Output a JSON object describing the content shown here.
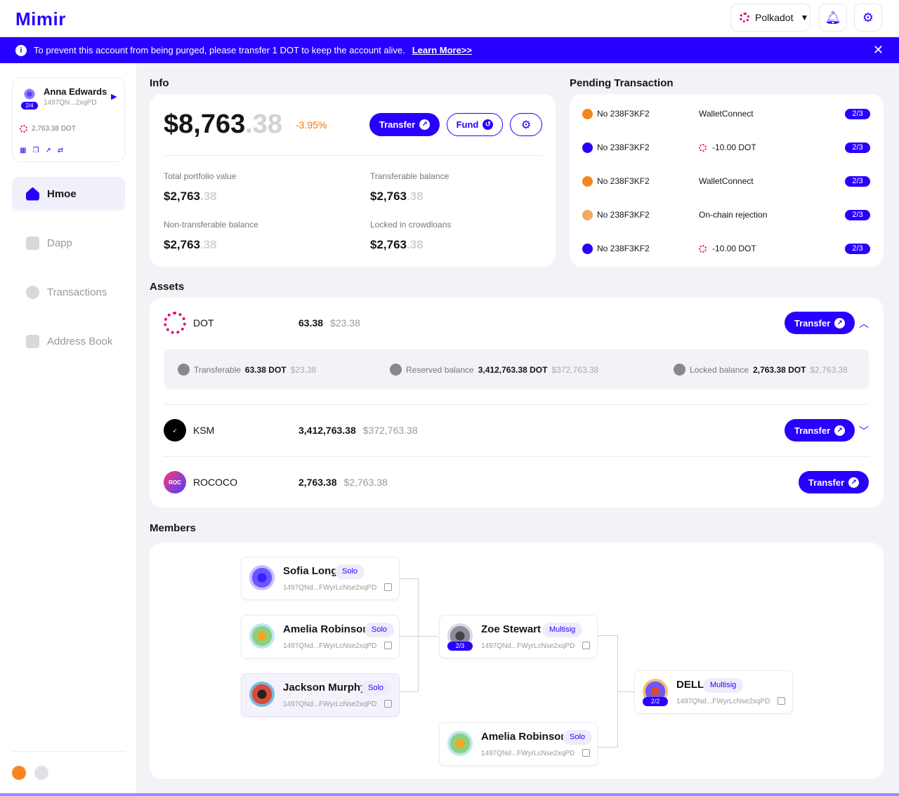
{
  "app": {
    "logo": "Mimir"
  },
  "header": {
    "network": "Polkadot",
    "notif_icon": "bell-icon",
    "settings_icon": "gear-icon"
  },
  "banner": {
    "message": "To prevent this account from being purged, please transfer 1 DOT to keep the account alive.",
    "link": "Learn More>>"
  },
  "account": {
    "name": "Anna Edwards",
    "badge": "2/4",
    "address": "1497QN...2xqPD",
    "balance": "2,763.38 DOT"
  },
  "nav": [
    {
      "label": "Hmoe",
      "icon": "home-icon"
    },
    {
      "label": "Dapp",
      "icon": "dapp-icon"
    },
    {
      "label": "Transactions",
      "icon": "transactions-icon"
    },
    {
      "label": "Address Book",
      "icon": "address-book-icon"
    }
  ],
  "info": {
    "title": "Info",
    "total": "$8,763",
    "total_dec": ".38",
    "change": "-3.95%",
    "transfer": "Transfer",
    "fund": "Fund",
    "kv": [
      {
        "k": "Total portfolio value",
        "v": "$2,763",
        "d": ".38"
      },
      {
        "k": "Transferable balance",
        "v": "$2,763",
        "d": ".38"
      },
      {
        "k": "Non-transferable balance",
        "v": "$2,763",
        "d": ".38"
      },
      {
        "k": "Locked in crowdloans",
        "v": "$2,763",
        "d": ".38"
      }
    ]
  },
  "pending": {
    "title": "Pending Transaction",
    "rows": [
      {
        "no": "No 238F3KF2",
        "desc": "WalletConnect",
        "frac": "2/3",
        "color": "#f5861f",
        "dot": false
      },
      {
        "no": "No 238F3KF2",
        "desc": "-10.00 DOT",
        "frac": "2/3",
        "color": "#2700ff",
        "dot": true
      },
      {
        "no": "No 238F3KF2",
        "desc": "WalletConnect",
        "frac": "2/3",
        "color": "#f5861f",
        "dot": false
      },
      {
        "no": "No 238F3KF2",
        "desc": "On-chain rejection",
        "frac": "2/3",
        "color": "#f5a860",
        "dot": false
      },
      {
        "no": "No 238F3KF2",
        "desc": "-10.00 DOT",
        "frac": "2/3",
        "color": "#2700ff",
        "dot": true
      }
    ]
  },
  "assets": {
    "title": "Assets",
    "rows": [
      {
        "sym": "DOT",
        "amt": "63.38",
        "usd": "$23.38",
        "btn": "Transfer"
      },
      {
        "sym": "KSM",
        "amt": "3,412,763.38",
        "usd": "$372,763.38",
        "btn": "Transfer"
      },
      {
        "sym": "ROCOCO",
        "amt": "2,763.38",
        "usd": "$2,763.38",
        "btn": "Transfer",
        "logo_text": "ROC"
      }
    ],
    "dot_detail": {
      "transferable_label": "Transferable",
      "transferable": "63.38 DOT",
      "transferable_usd": "$23.38",
      "reserved_label": "Reserved balance",
      "reserved": "3,412,763.38 DOT",
      "reserved_usd": "$372,763.38",
      "locked_label": "Locked balance",
      "locked": "2,763.38 DOT",
      "locked_usd": "$2,763.38"
    }
  },
  "members": {
    "title": "Members",
    "cards": [
      {
        "name": "Sofia Long",
        "tag": "Solo",
        "addr": "1497QNd...FWyrLcNse2xqPD"
      },
      {
        "name": "Amelia Robinson",
        "tag": "Solo",
        "addr": "1497QNd...FWyrLcNse2xqPD"
      },
      {
        "name": "Jackson Murphy",
        "tag": "Solo",
        "addr": "1497QNd...FWyrLcNse2xqPD"
      },
      {
        "name": "Zoe Stewart",
        "tag": "Multisig",
        "addr": "1497QNd...FWyrLcNse2xqPD",
        "badge": "2/3"
      },
      {
        "name": "Amelia Robinson",
        "tag": "Solo",
        "addr": "1497QNd...FWyrLcNse2xqPD"
      },
      {
        "name": "DELL",
        "tag": "Multisig",
        "addr": "1497QNd...FWyrLcNse2xqPD",
        "badge": "2/2"
      }
    ]
  }
}
